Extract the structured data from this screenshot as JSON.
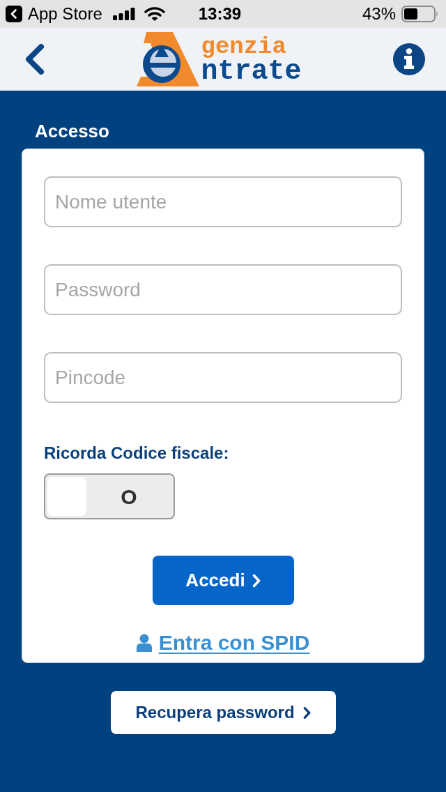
{
  "status_bar": {
    "back_app": "App Store",
    "time": "13:39",
    "battery": "43%"
  },
  "header": {
    "logo": {
      "line_1": "genzia",
      "line_2": "ntrate"
    }
  },
  "login": {
    "title": "Accesso",
    "fields": [
      {
        "placeholder": "Nome utente"
      },
      {
        "placeholder": "Password"
      },
      {
        "placeholder": "Pincode"
      }
    ],
    "remember": {
      "label": "Ricorda Codice fiscale:",
      "on": false,
      "toggle_text": "O"
    },
    "submit": "Accedi",
    "spid_link": "Entra con SPID"
  },
  "recover_button": "Recupera password"
}
